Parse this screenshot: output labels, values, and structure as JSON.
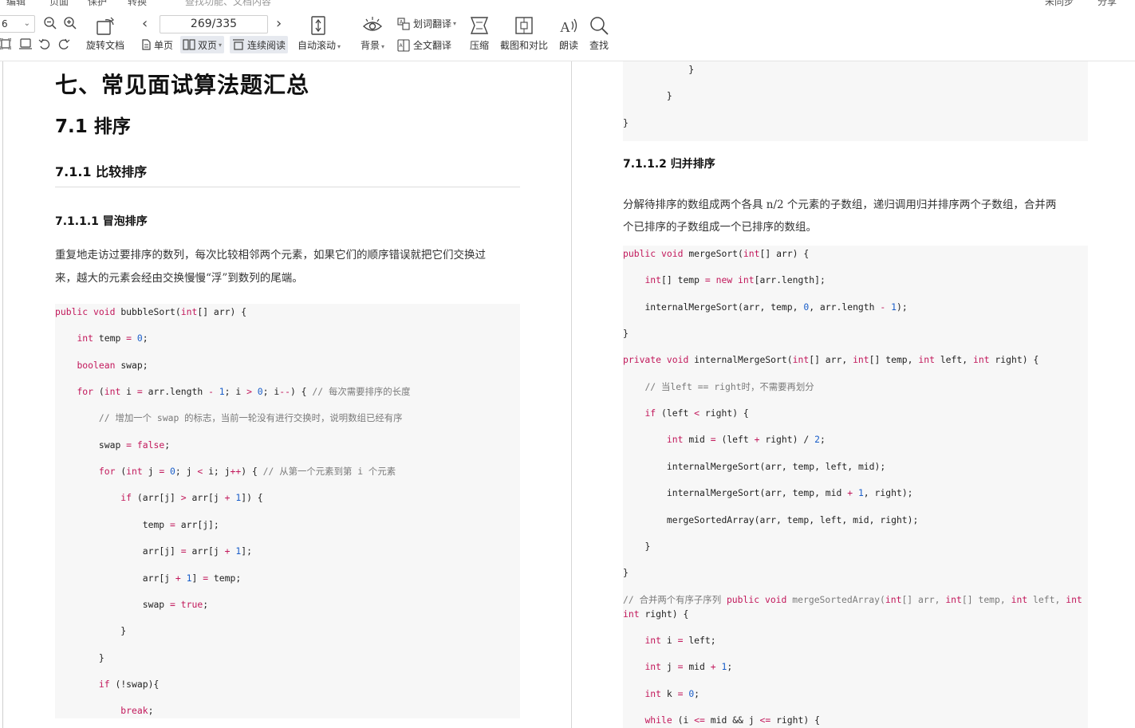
{
  "toolbar": {
    "top_cut": [
      "编辑",
      "页面",
      "保护",
      "转换",
      "查找功能、文档内容",
      "未同步",
      "分享"
    ],
    "zoom_value": "6",
    "page_indicator": "269/335",
    "rotate_label": "旋转文档",
    "single_page_label": "单页",
    "double_page_label": "双页",
    "continuous_label": "连续阅读",
    "auto_scroll_label": "自动滚动",
    "background_label": "背景",
    "word_translate_label": "划词翻译",
    "full_translate_label": "全文翻译",
    "compress_label": "压缩",
    "screenshot_compare_label": "截图和对比",
    "read_aloud_label": "朗读",
    "find_label": "查找"
  },
  "left_page": {
    "chapter_title": "七、常见面试算法题汇总",
    "section_title": "7.1  排序",
    "subsection_title": "7.1.1  比较排序",
    "subsubsection_title": "7.1.1.1  冒泡排序",
    "para_line1": "重复地走访过要排序的数列，每次比较相邻两个元素，如果它们的顺序错误就把它们交换过",
    "para_line2": "来，越大的元素会经由交换慢慢“浮”到数列的尾端。",
    "code_lines": [
      "public void bubbleSort(int[] arr) {",
      "    int temp = 0;",
      "    boolean swap;",
      "    for (int i = arr.length - 1; i > 0; i--) { // 每次需要排序的长度",
      "        // 增加一个 swap 的标志，当前一轮没有进行交换时，说明数组已经有序",
      "        swap = false;",
      "        for (int j = 0; j < i; j++) { // 从第一个元素到第 i 个元素",
      "            if (arr[j] > arr[j + 1]) {",
      "                temp = arr[j];",
      "                arr[j] = arr[j + 1];",
      "                arr[j + 1] = temp;",
      "                swap = true;",
      "            }",
      "        }",
      "        if (!swap){",
      "            break;"
    ]
  },
  "right_page": {
    "top_code_lines": [
      "            }",
      "        }",
      "}"
    ],
    "subsubsection_title": "7.1.1.2  归并排序",
    "para_line1": "分解待排序的数组成两个各具  n/2  个元素的子数组，递归调用归并排序两个子数组，合并两",
    "para_line2": "个已排序的子数组成一个已排序的数组。",
    "code_lines": [
      "public void mergeSort(int[] arr) {",
      "    int[] temp = new int[arr.length];",
      "    internalMergeSort(arr, temp, 0, arr.length - 1);",
      "}",
      "private void internalMergeSort(int[] arr, int[] temp, int left, int right) {",
      "    // 当left == right时，不需要再划分",
      "    if (left < right) {",
      "        int mid = (left + right) / 2;",
      "        internalMergeSort(arr, temp, left, mid);",
      "        internalMergeSort(arr, temp, mid + 1, right);",
      "        mergeSortedArray(arr, temp, left, mid, right);",
      "    }",
      "}",
      "// 合并两个有序子序列 public void mergeSortedArray(int[] arr, int[] temp, int left, int mid,",
      "int right) {",
      "    int i = left;",
      "    int j = mid + 1;",
      "    int k = 0;",
      "    while (i <= mid && j <= right) {"
    ]
  },
  "colors": {
    "keyword": "#c2185b",
    "number": "#1a5ec9",
    "comment": "#7a7a7a",
    "code_bg": "#f7f7f7",
    "toggle_active_bg": "#e6e9ef"
  }
}
